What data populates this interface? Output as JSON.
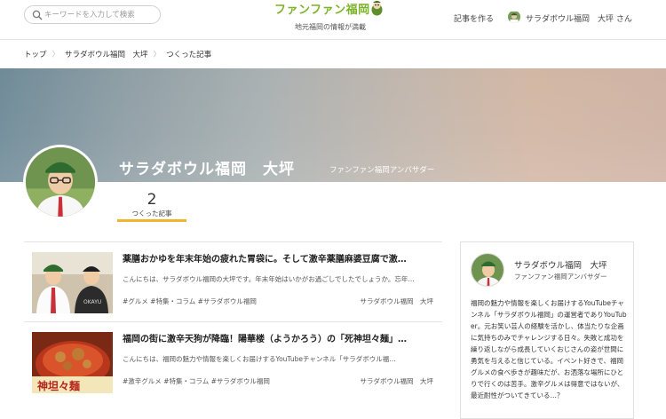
{
  "header": {
    "search_placeholder": "キーワードを入力して検索",
    "logo_text": "ファンファン福岡",
    "tagline": "地元福岡の情報が満載",
    "write_link": "記事を作る",
    "user_name": "サラダボウル福岡　大坪 さん"
  },
  "breadcrumb": [
    "トップ",
    "サラダボウル福岡　大坪",
    "つくった記事"
  ],
  "profile": {
    "name": "サラダボウル福岡　大坪",
    "role": "ファンファン福岡アンバサダー",
    "article_count": "2",
    "article_count_label": "つくった記事"
  },
  "articles": [
    {
      "title": "薬膳おかゆを年末年始の疲れた胃袋に。そして激辛薬膳麻婆豆腐で激…",
      "excerpt": "こんにちは、サラダボウル福岡の大坪です。年末年始はいかがお過ごしでしたでしょうか。忘年…",
      "tags": "#グルメ  #特集・コラム  #サラダボウル福岡",
      "author": "サラダボウル福岡　大坪"
    },
    {
      "title": "福岡の街に激辛天狗が降臨！陽華楼（ようかろう）の「死神坦々麺」…",
      "excerpt": "こんにちは、福岡の魅力や情報を楽しくお届けするYouTubeチャンネル「サラダボウル福…",
      "tags": "#激辛グルメ  #特集・コラム  #サラダボウル福岡",
      "author": "サラダボウル福岡　大坪"
    }
  ],
  "sidebar_card": {
    "name": "サラダボウル福岡　大坪",
    "role": "ファンファン福岡アンバサダー",
    "bio": "福岡の魅力や情報を楽しくお届けするYouTubeチャンネル「サラダボウル福岡」の運営者でありYouTuber。元お笑い芸人の経験を活かし、体当たりな企画に気持ちのみでチャレンジする日々。失敗と成功を繰り返しながら成長していくおじさんの姿が世間に勇気を与えると信じている。イベント好きで、福岡グルメの食べ歩きが趣味だが、お洒落な場所にひとりで行くのは苦手。激辛グルメは得意ではないが、最近耐性がついてきている…？"
  },
  "colors": {
    "brand_green": "#7cb32a",
    "accent_orange": "#f0b42e"
  },
  "icons": [
    "search-icon",
    "mascot-icon",
    "avatar"
  ]
}
